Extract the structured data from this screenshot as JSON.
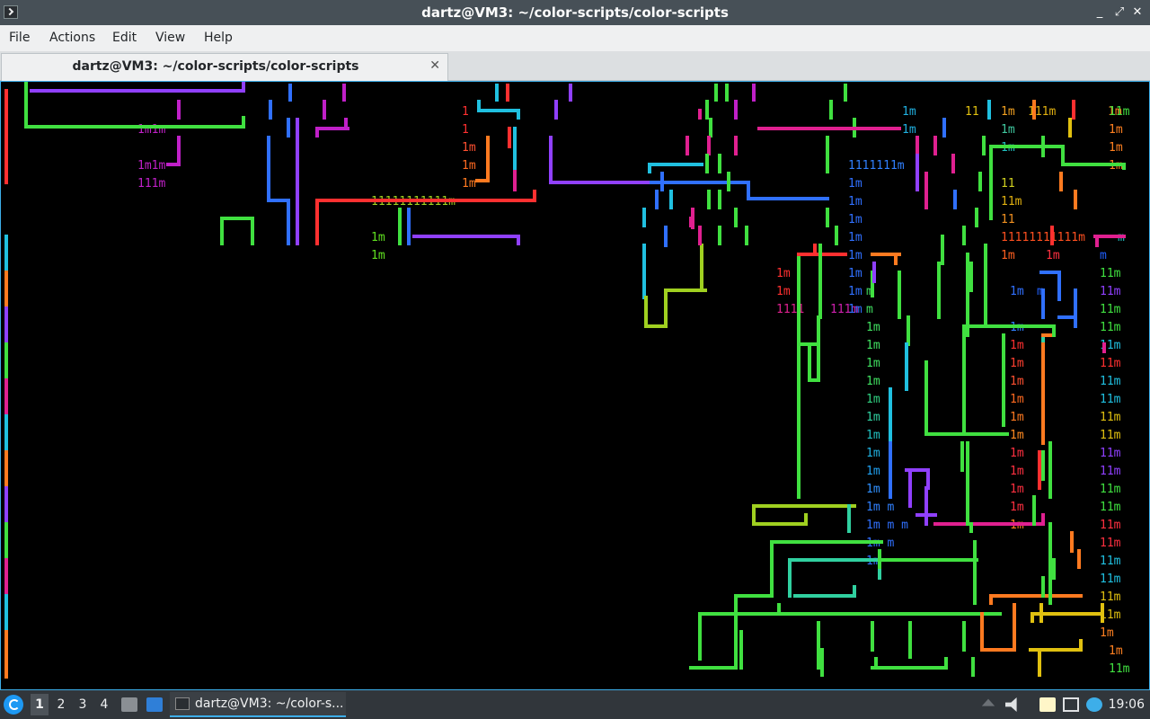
{
  "window": {
    "title": "dartz@VM3: ~/color-scripts/color-scripts",
    "controls": {
      "minimize": "_",
      "maximize": "⤢",
      "close": "✕"
    }
  },
  "menubar": {
    "items": [
      "File",
      "Actions",
      "Edit",
      "View",
      "Help"
    ]
  },
  "tabs": [
    {
      "label": "dartz@VM3: ~/color-scripts/color-scripts",
      "close": "✕",
      "active": true
    }
  ],
  "terminal": {
    "background": "#000000",
    "text_runs": [
      {
        "text": "1m1m",
        "color": "#c020c8"
      },
      {
        "text": "1m1m",
        "color": "#c020c8"
      },
      {
        "text": "111m",
        "color": "#c020c8"
      },
      {
        "text": "1",
        "color": "#ff3030"
      },
      {
        "text": "1",
        "color": "#ff3030"
      },
      {
        "text": "1m",
        "color": "#ff5030"
      },
      {
        "text": "1m",
        "color": "#ff6a20"
      },
      {
        "text": "1m",
        "color": "#ff7a20"
      },
      {
        "text": "11111111111m",
        "color": "#a0d020"
      },
      {
        "text": "1m",
        "color": "#60e020"
      },
      {
        "text": "1m",
        "color": "#60e020"
      },
      {
        "text": "1m",
        "color": "#20b0e0"
      },
      {
        "text": "1m",
        "color": "#20b0e0"
      },
      {
        "text": "11",
        "color": "#e0c010"
      },
      {
        "text": "1m",
        "color": "#f0a020"
      },
      {
        "text": "111m",
        "color": "#e0b010"
      },
      {
        "text": "1m",
        "color": "#ff8020"
      },
      {
        "text": "1m",
        "color": "#40c8a0"
      },
      {
        "text": "1m",
        "color": "#20c0c0"
      },
      {
        "text": "1111111m",
        "color": "#3080ff"
      },
      {
        "text": "1m",
        "color": "#3070ff"
      },
      {
        "text": "1m",
        "color": "#3070ff"
      },
      {
        "text": "1m",
        "color": "#3070ff"
      },
      {
        "text": "1m",
        "color": "#3070ff"
      },
      {
        "text": "1m",
        "color": "#3070ff"
      },
      {
        "text": "1m",
        "color": "#3070ff"
      },
      {
        "text": "1m",
        "color": "#ff3030"
      },
      {
        "text": "1m",
        "color": "#ff3030"
      },
      {
        "text": "1111",
        "color": "#e02090"
      },
      {
        "text": "111m",
        "color": "#d020b0"
      },
      {
        "text": "11",
        "color": "#d0d020"
      },
      {
        "text": "11m",
        "color": "#e0b010"
      },
      {
        "text": "11",
        "color": "#f09020"
      },
      {
        "text": "11111111111m",
        "color": "#ff5020"
      },
      {
        "text": "m",
        "color": "#20c0c0"
      },
      {
        "text": "1m",
        "color": "#ff6020"
      },
      {
        "text": "1m",
        "color": "#ff3040"
      },
      {
        "text": "1m",
        "color": "#3070ff"
      },
      {
        "text": "1m",
        "color": "#3070ff"
      },
      {
        "text": "1m",
        "color": "#3070ff"
      },
      {
        "text": "m",
        "color": "#40e060"
      },
      {
        "text": "m",
        "color": "#40e060"
      },
      {
        "text": "1m",
        "color": "#40e060"
      },
      {
        "text": "1m",
        "color": "#40e060"
      },
      {
        "text": "1m",
        "color": "#40e060"
      },
      {
        "text": "1m",
        "color": "#40e060"
      },
      {
        "text": "1m",
        "color": "#30d080"
      },
      {
        "text": "1m",
        "color": "#30d0a0"
      },
      {
        "text": "1m",
        "color": "#20c0c0"
      },
      {
        "text": "1m",
        "color": "#20b0e0"
      },
      {
        "text": "1m",
        "color": "#20a0f0"
      },
      {
        "text": "1m",
        "color": "#3090ff"
      },
      {
        "text": "1m m",
        "color": "#3080ff"
      },
      {
        "text": "1m m m",
        "color": "#3070ff"
      },
      {
        "text": "1m m",
        "color": "#3070ff"
      },
      {
        "text": "1m",
        "color": "#3070ff"
      },
      {
        "text": "1m",
        "color": "#3080ff"
      },
      {
        "text": "1m",
        "color": "#ff3030"
      },
      {
        "text": "1m",
        "color": "#ff4030"
      },
      {
        "text": "1m",
        "color": "#ff5030"
      },
      {
        "text": "1m",
        "color": "#ff6a20"
      },
      {
        "text": "1m",
        "color": "#ff7a20"
      },
      {
        "text": "1m",
        "color": "#ff8a20"
      },
      {
        "text": "1m",
        "color": "#ff3040"
      },
      {
        "text": "1m",
        "color": "#ff3040"
      },
      {
        "text": "1m",
        "color": "#ff3040"
      },
      {
        "text": "1m",
        "color": "#ff3040"
      },
      {
        "text": "1m",
        "color": "#ff8020"
      },
      {
        "text": "11m",
        "color": "#40e040"
      },
      {
        "text": "11m",
        "color": "#40e040"
      },
      {
        "text": "11m",
        "color": "#9040ff"
      },
      {
        "text": "11m",
        "color": "#40e040"
      },
      {
        "text": "11m",
        "color": "#40e040"
      },
      {
        "text": "11m",
        "color": "#20c0e0"
      },
      {
        "text": "11m",
        "color": "#ff3030"
      },
      {
        "text": "11m",
        "color": "#20c0e0"
      },
      {
        "text": "11m",
        "color": "#20c0e0"
      },
      {
        "text": "11m",
        "color": "#e0c010"
      },
      {
        "text": "11m",
        "color": "#e0c010"
      },
      {
        "text": "11m",
        "color": "#9040ff"
      },
      {
        "text": "11m",
        "color": "#9040ff"
      },
      {
        "text": "11m",
        "color": "#40e040"
      },
      {
        "text": "11m",
        "color": "#40e040"
      },
      {
        "text": "11m",
        "color": "#ff3040"
      },
      {
        "text": "11m",
        "color": "#ff3040"
      },
      {
        "text": "11m",
        "color": "#20c0e0"
      },
      {
        "text": "11m",
        "color": "#20c0e0"
      },
      {
        "text": "11m",
        "color": "#e0c010"
      },
      {
        "text": "11m",
        "color": "#e0c010"
      },
      {
        "text": "1m",
        "color": "#ff8020"
      },
      {
        "text": "1m",
        "color": "#ff8020"
      },
      {
        "text": "1m",
        "color": "#ff8020"
      },
      {
        "text": "1m",
        "color": "#ff8020"
      },
      {
        "text": "1m",
        "color": "#ff8020"
      },
      {
        "text": "11m",
        "color": "#40e040"
      },
      {
        "text": "m",
        "color": "#2060ff"
      },
      {
        "text": "m",
        "color": "#2060ff"
      }
    ],
    "line_segments": {
      "colors": [
        "#ff3030",
        "#ff7a20",
        "#e0c010",
        "#a0d020",
        "#40e040",
        "#30d0a0",
        "#20c0e0",
        "#3070ff",
        "#9040ff",
        "#c020c8",
        "#e02090"
      ]
    }
  },
  "taskbar": {
    "desktops": [
      "1",
      "2",
      "3",
      "4"
    ],
    "active_desktop": "1",
    "task_label": "dartz@VM3: ~/color-s...",
    "clock": "19:06",
    "tray_icons": [
      "arrow-up-icon",
      "volume-icon",
      "clipboard-icon",
      "network-icon",
      "update-notifier-icon"
    ]
  }
}
